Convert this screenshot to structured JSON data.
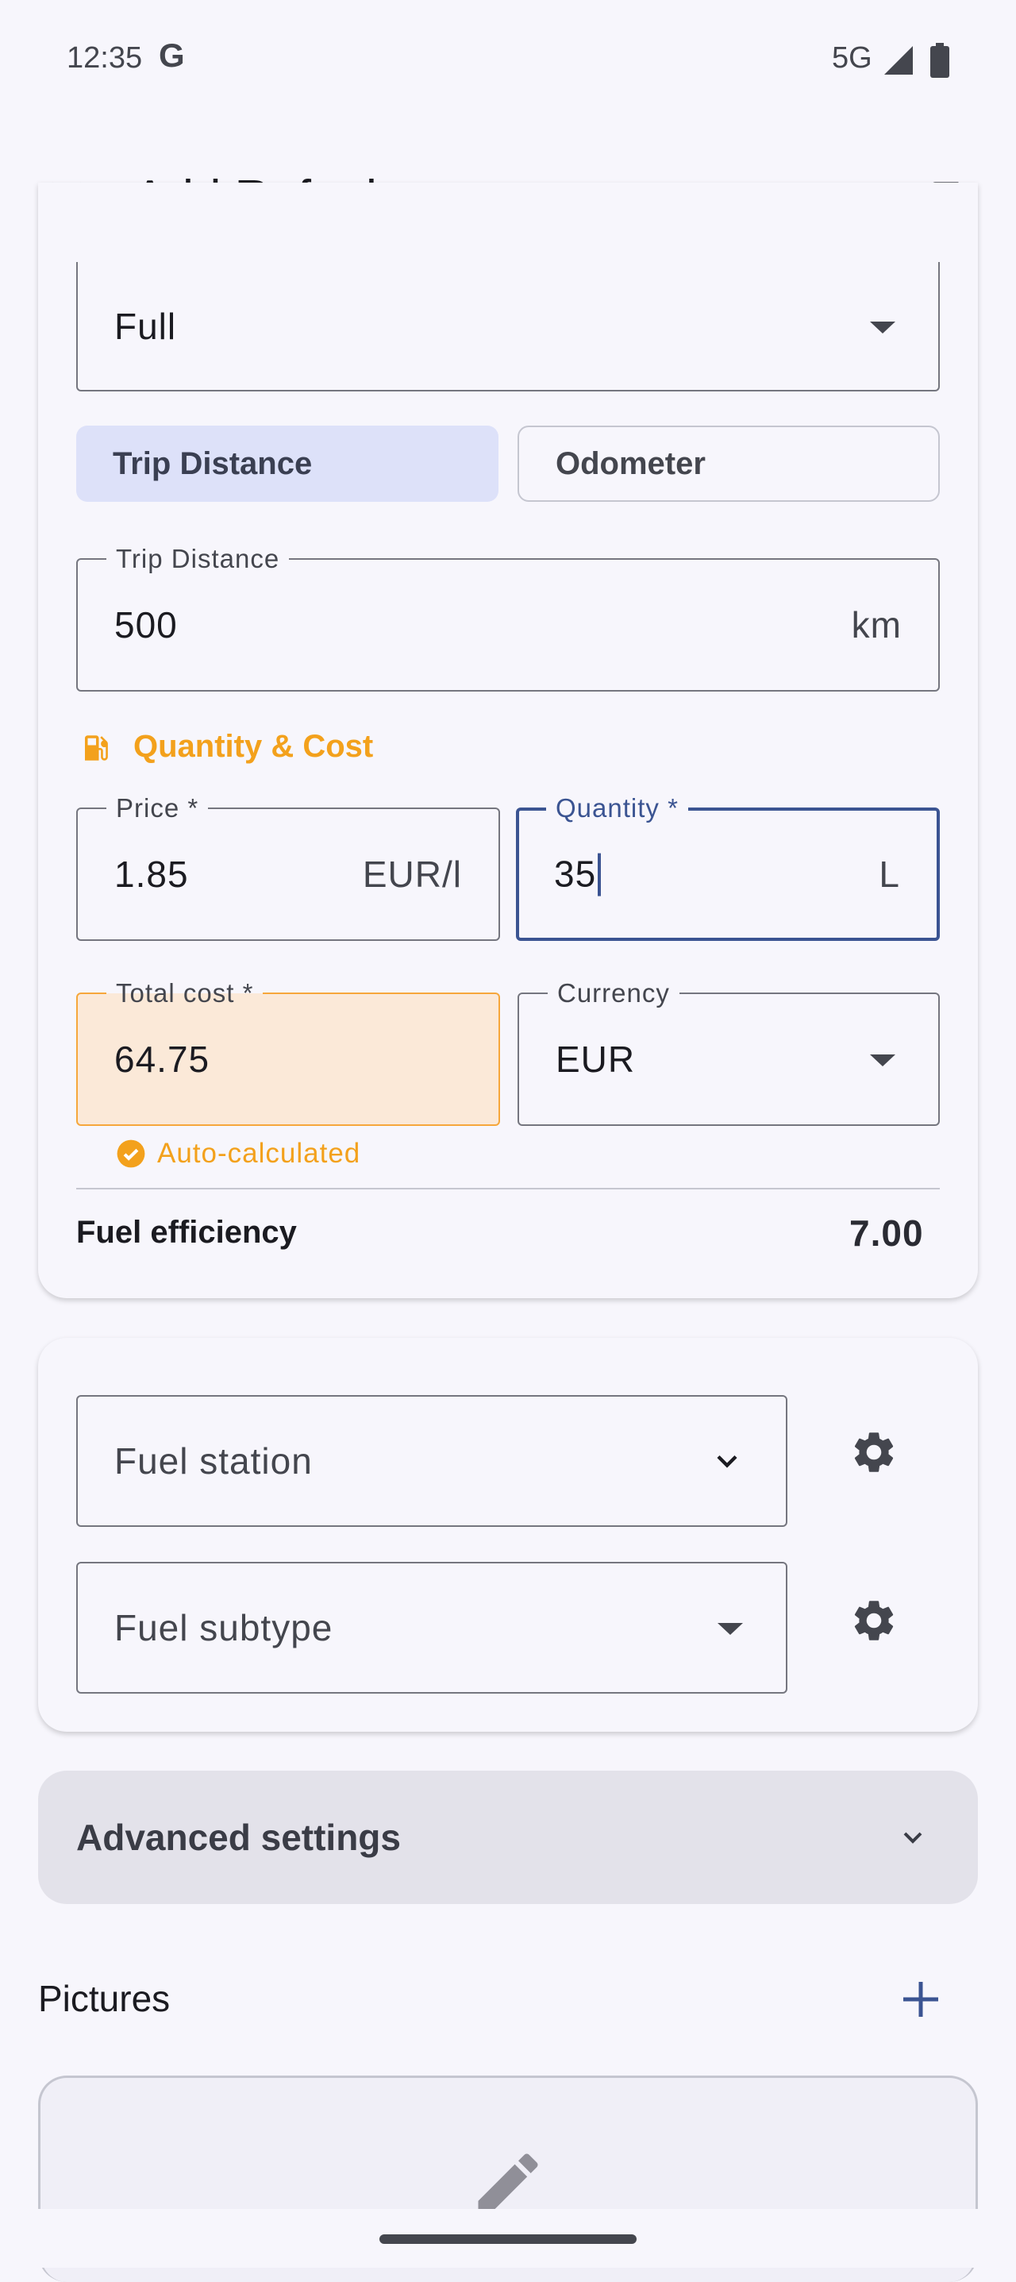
{
  "status_bar": {
    "time": "12:35",
    "google_glyph": "G",
    "network": "5G",
    "signal_icon": "cell-signal-icon",
    "battery_icon": "battery-icon"
  },
  "top_bar": {
    "title": "Add Refuel",
    "close_icon": "close-icon",
    "save_icon": "save-icon"
  },
  "form": {
    "fill_type": {
      "value": "Full"
    },
    "distance_mode": {
      "options": [
        "Trip Distance",
        "Odometer"
      ],
      "selected": "Trip Distance"
    },
    "trip_distance": {
      "label": "Trip Distance",
      "value": "500",
      "unit": "km"
    },
    "quantity_cost_section": {
      "title": "Quantity & Cost",
      "icon": "fuel-pump-icon"
    },
    "price": {
      "label": "Price *",
      "value": "1.85",
      "unit": "EUR/l"
    },
    "quantity": {
      "label": "Quantity *",
      "value": "35",
      "unit": "L"
    },
    "total_cost": {
      "label": "Total cost *",
      "value": "64.75",
      "helper": "Auto-calculated"
    },
    "currency": {
      "label": "Currency",
      "value": "EUR"
    },
    "fuel_efficiency": {
      "label": "Fuel efficiency",
      "value": "7.00"
    }
  },
  "station_card": {
    "fuel_station": {
      "placeholder": "Fuel station"
    },
    "fuel_subtype": {
      "placeholder": "Fuel subtype"
    }
  },
  "advanced": {
    "label": "Advanced settings"
  },
  "pictures": {
    "title": "Pictures"
  },
  "colors": {
    "accent": "#3b5492",
    "warning": "#f3a11c",
    "selected_segment": "#dde1f9",
    "auto_field_bg": "#fbe9d8"
  }
}
